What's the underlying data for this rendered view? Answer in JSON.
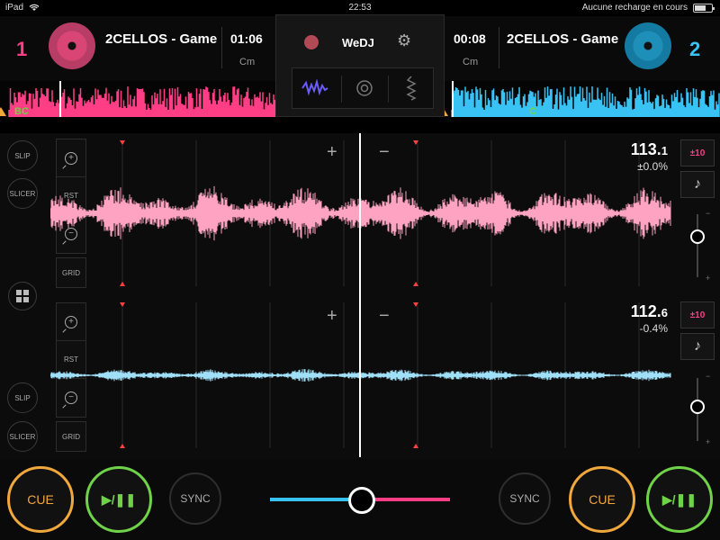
{
  "status_bar": {
    "device": "iPad",
    "time": "22:53",
    "charging": "Aucune recharge en cours"
  },
  "app": {
    "name": "WeDJ"
  },
  "deck1": {
    "number": "1",
    "title": "2CELLOS - Game",
    "time": "01:06",
    "key": "Cm",
    "overview_key": "BC",
    "bpm_int": "113.",
    "bpm_frac": "1",
    "pitch": "±0.0%",
    "range": "±10",
    "color": "#ff3e85",
    "pitch_position": 0.35
  },
  "deck2": {
    "number": "2",
    "title": "2CELLOS - Game",
    "time": "00:08",
    "key": "Cm",
    "overview_key": "C",
    "bpm_int": "112.",
    "bpm_frac": "6",
    "pitch": "-0.4%",
    "range": "±10",
    "color": "#39c3f5",
    "pitch_position": 0.45
  },
  "controls": {
    "slip": "SLIP",
    "slicer": "SLICER",
    "rst": "RST",
    "grid": "GRID",
    "cue": "CUE",
    "play": "▶/❚❚",
    "sync": "SYNC",
    "plus": "+",
    "minus": "−",
    "pitch_plus": "+",
    "pitch_minus": "−",
    "note": "♪"
  },
  "crossfader": {
    "position": 0.51
  }
}
